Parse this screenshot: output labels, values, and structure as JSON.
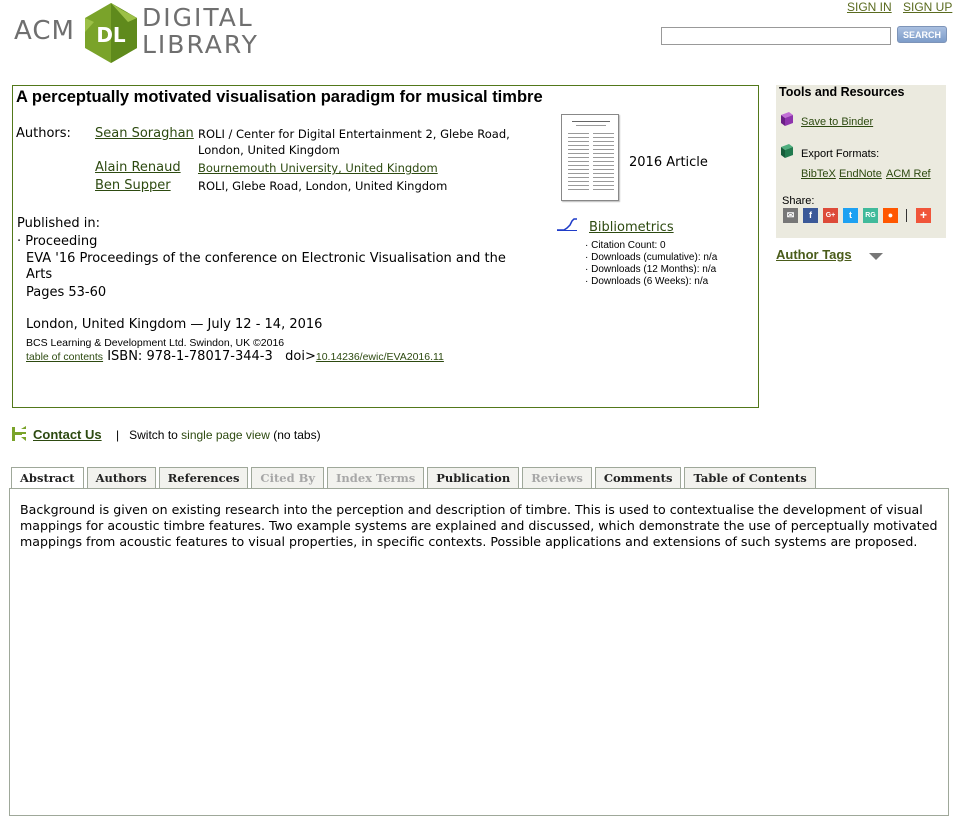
{
  "header": {
    "logo_acm": "ACM",
    "logo_dl": "DL",
    "logo_line1": "DIGITAL",
    "logo_line2": "LIBRARY",
    "sign_in": "SIGN IN",
    "sign_up": "SIGN UP",
    "search_value": "",
    "search_button": "SEARCH"
  },
  "paper": {
    "title": "A perceptually motivated visualisation paradigm for musical timbre",
    "authors_label": "Authors:",
    "authors": [
      {
        "name": "Sean Soraghan",
        "affiliation": "ROLI / Center for Digital Entertainment 2, Glebe Road, London, United Kingdom"
      },
      {
        "name": "Alain Renaud",
        "affiliation": "Bournemouth University, United Kingdom"
      },
      {
        "name": "Ben Supper",
        "affiliation": "ROLI, Glebe Road, London, United Kingdom"
      }
    ],
    "published_in_label": "Published in:",
    "proceeding_label": "· Proceeding",
    "proceedings_title": "EVA '16 Proceedings of the conference on Electronic Visualisation and the Arts",
    "pages": "Pages 53-60",
    "location_date": "London, United Kingdom — July 12 - 14, 2016",
    "publisher": "BCS Learning & Development Ltd. Swindon, UK ©2016",
    "toc_link": "table of contents",
    "isbn": "ISBN: 978-1-78017-344-3",
    "doi_label": "doi>",
    "doi": "10.14236/ewic/EVA2016.11",
    "year_type": "2016 Article",
    "bibliometrics_label": "Bibliometrics",
    "metrics": [
      "· Citation Count: 0",
      "· Downloads (cumulative): n/a",
      "· Downloads (12 Months): n/a",
      "· Downloads (6 Weeks): n/a"
    ]
  },
  "tools": {
    "title": "Tools and Resources",
    "save_binder": "Save to Binder",
    "export_label": "Export Formats:",
    "export_bibtex": "BibTeX",
    "export_endnote": "EndNote",
    "export_acmref": "ACM Ref",
    "share_label": "Share:",
    "author_tags": "Author Tags",
    "colors": {
      "panel_bg": "#ebeadf",
      "link": "#2d4a10",
      "border": "#52781a"
    }
  },
  "contact": {
    "contact_us": "Contact Us",
    "separator": "|",
    "switch_to": "Switch to",
    "single_page": "single page view",
    "no_tabs": "(no tabs)"
  },
  "tabs": [
    {
      "label": "Abstract",
      "state": "active"
    },
    {
      "label": "Authors",
      "state": "normal"
    },
    {
      "label": "References",
      "state": "normal"
    },
    {
      "label": "Cited By",
      "state": "disabled"
    },
    {
      "label": "Index Terms",
      "state": "disabled"
    },
    {
      "label": "Publication",
      "state": "normal"
    },
    {
      "label": "Reviews",
      "state": "disabled"
    },
    {
      "label": "Comments",
      "state": "normal"
    },
    {
      "label": "Table of Contents",
      "state": "normal"
    }
  ],
  "abstract": "Background is given on existing research into the perception and description of timbre. This is used to contextualise the development of visual mappings for acoustic timbre features. Two example systems are explained and discussed, which demonstrate the use of perceptually motivated mappings from acoustic features to visual properties, in specific contexts. Possible applications and extensions of such systems are proposed."
}
